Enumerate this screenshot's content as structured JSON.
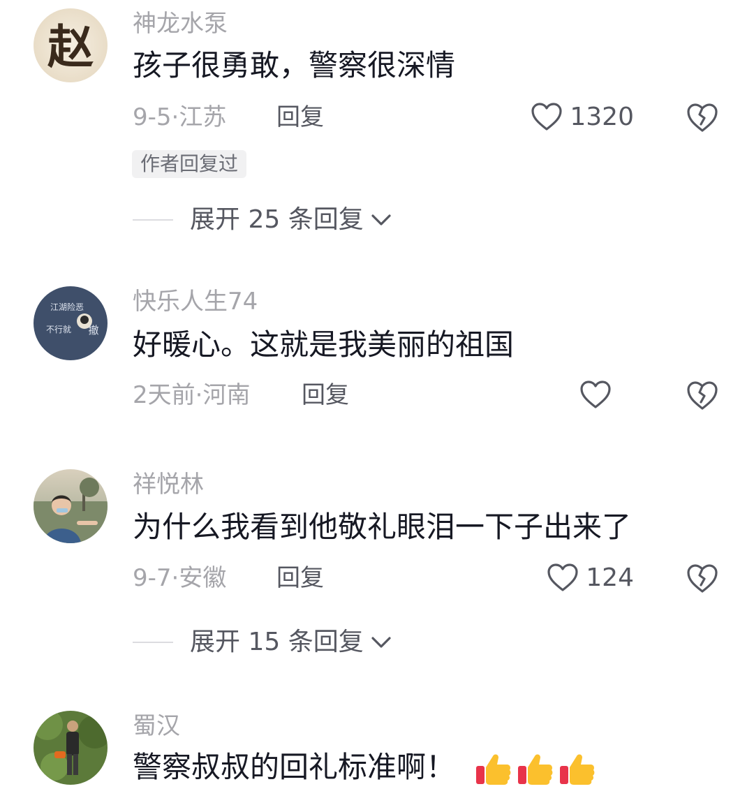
{
  "comments": [
    {
      "username": "神龙水泵",
      "avatar_icon": "zhao-calligraphy-avatar",
      "content": "孩子很勇敢，警察很深情",
      "meta": "9-5·江苏",
      "reply_label": "回复",
      "likes": "1320",
      "badge": "作者回复过",
      "expand_label": "展开 25 条回复"
    },
    {
      "username": "快乐人生74",
      "avatar_icon": "slogan-avatar",
      "avatar_text_top": "江湖险恶",
      "avatar_text_bottom": "不行就",
      "avatar_text_side": "撤",
      "content": "好暖心。这就是我美丽的祖国",
      "meta": "2天前·河南",
      "reply_label": "回复",
      "likes": ""
    },
    {
      "username": "祥悦林",
      "avatar_icon": "person-photo-avatar",
      "content": "为什么我看到他敬礼眼泪一下子出来了",
      "meta": "9-7·安徽",
      "reply_label": "回复",
      "likes": "124",
      "expand_label": "展开 15 条回复"
    },
    {
      "username": "蜀汉",
      "avatar_icon": "worker-photo-avatar",
      "content": "警察叔叔的回礼标准啊！",
      "emojis": [
        "thumbs-up-icon",
        "thumbs-up-icon",
        "thumbs-up-icon"
      ]
    }
  ],
  "colors": {
    "text_primary": "#161823",
    "text_secondary": "#a5a5aa",
    "text_action": "#555760",
    "badge_bg": "#f1f1f2"
  }
}
